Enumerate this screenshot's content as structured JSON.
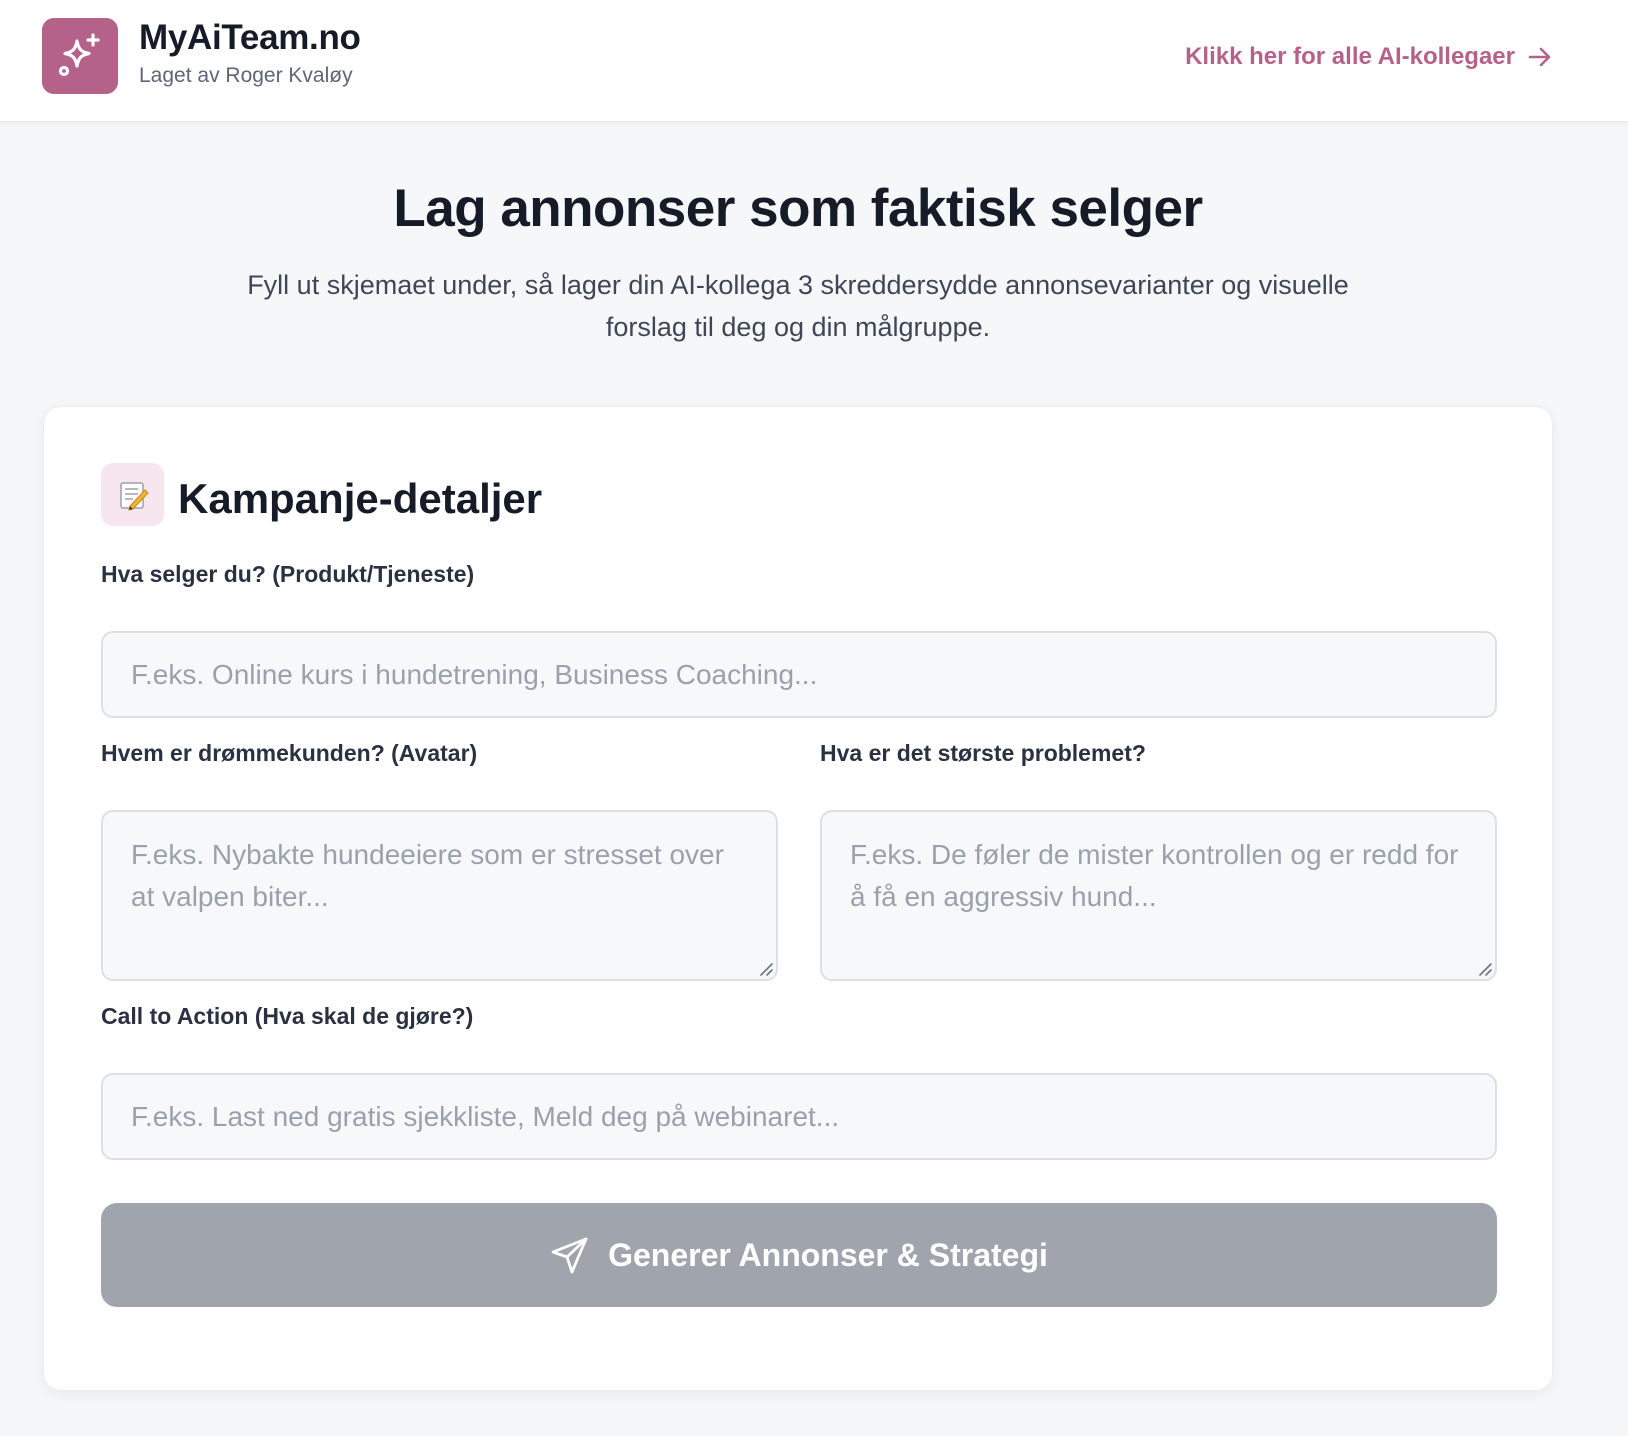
{
  "brand": {
    "name": "MyAiTeam.no",
    "tagline": "Laget av Roger Kvaløy",
    "logo_icon": "sparkles-icon",
    "accent_color": "#b5628b"
  },
  "header": {
    "link_label": "Klikk her for alle AI-kollegaer",
    "link_icon": "arrow-right-icon"
  },
  "hero": {
    "title": "Lag annonser som faktisk selger",
    "subtitle": "Fyll ut skjemaet under, så lager din AI-kollega 3 skreddersydde annonsevarianter og visuelle forslag til deg og din målgruppe."
  },
  "form": {
    "section_icon": "memo-icon",
    "section_title": "Kampanje-detaljer",
    "product": {
      "label": "Hva selger du? (Produkt/Tjeneste)",
      "value": "",
      "placeholder": "F.eks. Online kurs i hundetrening, Business Coaching..."
    },
    "avatar": {
      "label": "Hvem er drømmekunden? (Avatar)",
      "value": "",
      "placeholder": "F.eks. Nybakte hundeeiere som er stresset over at valpen biter..."
    },
    "problem": {
      "label": "Hva er det største problemet?",
      "value": "",
      "placeholder": "F.eks. De føler de mister kontrollen og er redd for å få en aggressiv hund..."
    },
    "cta": {
      "label": "Call to Action (Hva skal de gjøre?)",
      "value": "",
      "placeholder": "F.eks. Last ned gratis sjekkliste, Meld deg på webinaret..."
    },
    "submit": {
      "label": "Generer Annonser & Strategi",
      "icon": "send-icon",
      "color": "#a0a4ad"
    }
  }
}
